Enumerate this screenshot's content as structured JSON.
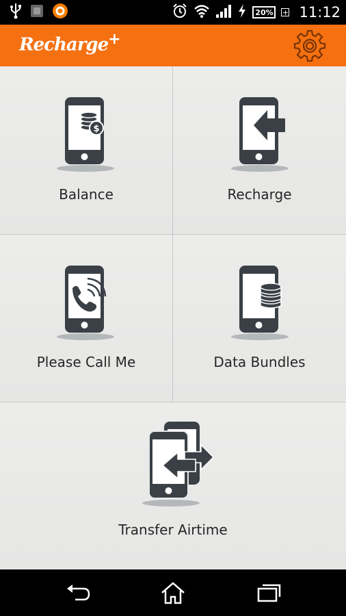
{
  "status_bar": {
    "battery_percent": "20%",
    "battery_plus": "+",
    "time": "11:12"
  },
  "app_bar": {
    "logo_text": "Recharge",
    "logo_suffix": "+"
  },
  "tiles": [
    {
      "label": "Balance"
    },
    {
      "label": "Recharge"
    },
    {
      "label": "Please Call Me"
    },
    {
      "label": "Data Bundles"
    },
    {
      "label": "Transfer Airtime"
    }
  ],
  "colors": {
    "app_bar": "#f57011",
    "phone_icon": "#3a4046",
    "background": "#ebebea"
  },
  "icons": {
    "status_left": [
      "usb-icon",
      "app-notification-icon",
      "orange-circle-app-icon"
    ],
    "status_right": [
      "alarm-clock-icon",
      "wifi-icon",
      "signal-icon",
      "charging-icon"
    ],
    "navigation": [
      "back-icon",
      "home-icon",
      "recent-apps-icon"
    ]
  }
}
